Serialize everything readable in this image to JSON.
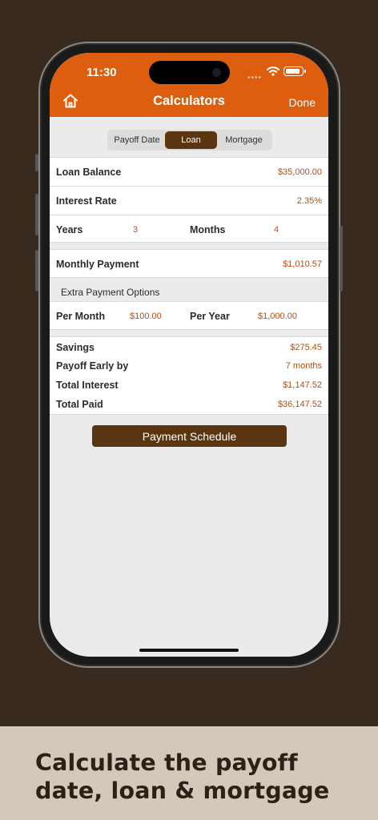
{
  "status_bar": {
    "time": "11:30",
    "battery_level": 0.9
  },
  "nav": {
    "title": "Calculators",
    "done_label": "Done",
    "home_icon": "home-icon"
  },
  "segments": {
    "items": [
      "Payoff Date",
      "Loan",
      "Mortgage"
    ],
    "selected": "Loan"
  },
  "loan": {
    "balance_label": "Loan Balance",
    "balance_value": "$35,000.00",
    "rate_label": "Interest Rate",
    "rate_value": "2.35%",
    "years_label": "Years",
    "years_value": "3",
    "months_label": "Months",
    "months_value": "4",
    "payment_label": "Monthly Payment",
    "payment_value": "$1,010.57"
  },
  "extra": {
    "header": "Extra Payment Options",
    "per_month_label": "Per Month",
    "per_month_value": "$100.00",
    "per_year_label": "Per Year",
    "per_year_value": "$1,000.00"
  },
  "results": {
    "savings_label": "Savings",
    "savings_value": "$275.45",
    "early_label": "Payoff Early by",
    "early_value": "7 months",
    "interest_label": "Total Interest",
    "interest_value": "$1,147.52",
    "paid_label": "Total Paid",
    "paid_value": "$36,147.52"
  },
  "schedule_button": "Payment Schedule",
  "caption": "Calculate the payoff date, loan & mortgage",
  "colors": {
    "header": "#dd5e0e",
    "accent_dark": "#5a3512",
    "value_text": "#b04f14",
    "background": "#382a1f",
    "caption_bg": "#d2c9bb"
  }
}
